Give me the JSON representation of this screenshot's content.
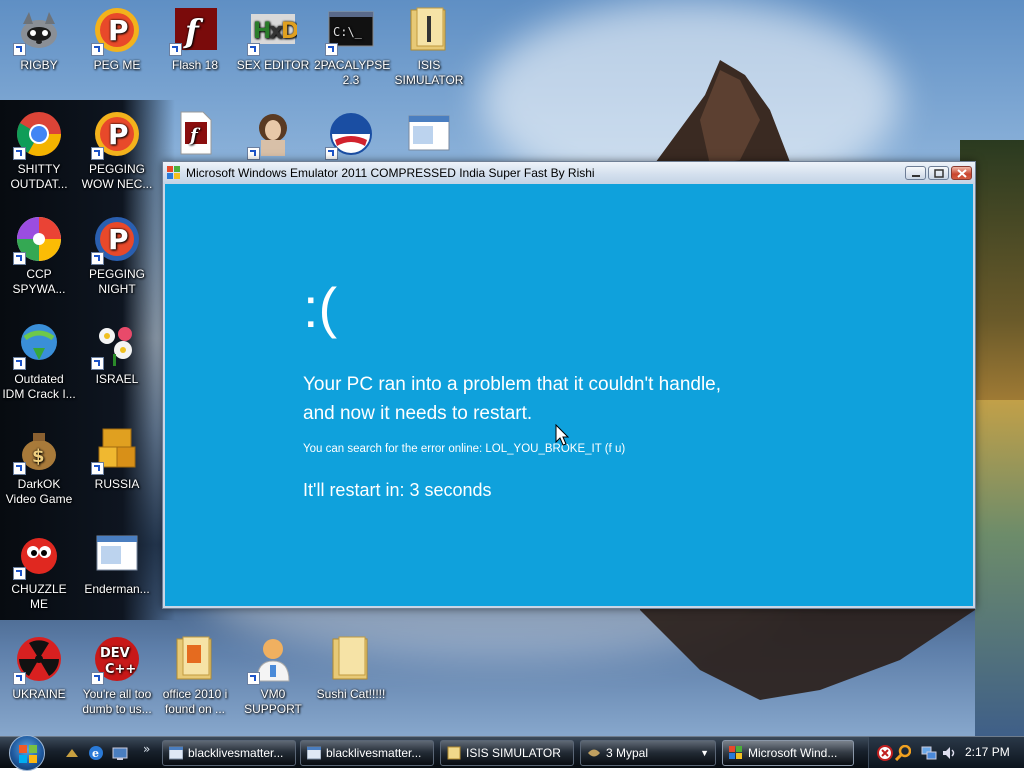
{
  "desktop": {
    "icons": [
      {
        "label": "RIGBY",
        "icon": "raccoon-icon"
      },
      {
        "label": "PEG ME",
        "icon": "peggle-icon"
      },
      {
        "label": "Flash 18",
        "icon": "flash-icon"
      },
      {
        "label": "SEX EDITOR",
        "icon": "hxd-icon"
      },
      {
        "label": "2PACALYPSE 2.3",
        "icon": "terminal-icon"
      },
      {
        "label": "ISIS SIMULATOR",
        "icon": "folder-icon"
      },
      {
        "label": "SHITTY OUTDAT...",
        "icon": "chrome-icon"
      },
      {
        "label": "PEGGING WOW NEC...",
        "icon": "peggle-icon"
      },
      {
        "label": "",
        "icon": "flash-file-icon"
      },
      {
        "label": "",
        "icon": "portrait-icon"
      },
      {
        "label": "",
        "icon": "obama-logo-icon"
      },
      {
        "label": "",
        "icon": "window-icon"
      },
      {
        "label": "CCP SPYWA...",
        "icon": "pinwheel-icon"
      },
      {
        "label": "PEGGING NIGHT",
        "icon": "peggle-night-icon"
      },
      {
        "label": "Outdated IDM Crack I...",
        "icon": "idm-icon"
      },
      {
        "label": "ISRAEL",
        "icon": "flower-icon"
      },
      {
        "label": "DarkOK Video Game",
        "icon": "money-bag-icon"
      },
      {
        "label": "RUSSIA",
        "icon": "gold-blocks-icon"
      },
      {
        "label": "CHUZZLE ME",
        "icon": "chuzzle-icon"
      },
      {
        "label": "Enderman...",
        "icon": "window-icon"
      },
      {
        "label": "UKRAINE",
        "icon": "radiation-icon"
      },
      {
        "label": "You're all too dumb to us...",
        "icon": "devcpp-icon"
      },
      {
        "label": "office 2010 i found on ...",
        "icon": "folder-icon"
      },
      {
        "label": "VM0 SUPPORT",
        "icon": "doctor-icon"
      },
      {
        "label": "Sushi Cat!!!!!",
        "icon": "folder-icon"
      }
    ]
  },
  "window": {
    "title": "Microsoft Windows Emulator 2011 COMPRESSED India Super Fast By Rishi",
    "bsod": {
      "face": ":(",
      "line1": "Your PC ran into a problem that it couldn't handle,",
      "line2": "and now it needs to restart.",
      "error": "You can search for the error online: LOL_YOU_BROKE_IT (f u)",
      "restart": "It'll restart in: 3 seconds",
      "bg_color": "#0fa1dc"
    }
  },
  "taskbar": {
    "tasks": [
      {
        "label": "blacklivesmatter...",
        "icon": "explorer-window-icon"
      },
      {
        "label": "blacklivesmatter...",
        "icon": "explorer-window-icon"
      },
      {
        "label": "ISIS SIMULATOR",
        "icon": "folder-icon"
      },
      {
        "label": "3 Mypal",
        "icon": "mypal-icon"
      },
      {
        "label": "Microsoft Wind...",
        "icon": "windows-flag-icon"
      }
    ],
    "clock": "2:17 PM"
  }
}
